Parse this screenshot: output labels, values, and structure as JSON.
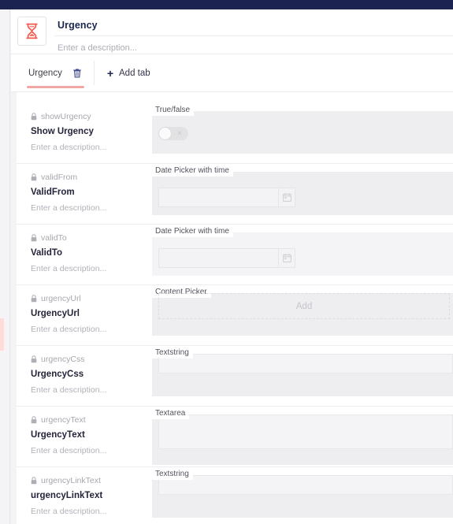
{
  "topbar": {
    "color": "#1b2350"
  },
  "header": {
    "icon": "hourglass-icon",
    "name": "Urgency",
    "description_placeholder": "Enter a description..."
  },
  "tabbar": {
    "tabs": [
      {
        "label": "Urgency",
        "active": true,
        "delete_icon": "trash-icon"
      }
    ],
    "add_tab_label": "Add tab",
    "add_tab_icon": "plus-icon"
  },
  "properties": [
    {
      "alias": "showUrgency",
      "label": "Show Urgency",
      "description_placeholder": "Enter a description...",
      "editor_type": "True/false",
      "lock_icon": "lock-icon",
      "control": "toggle",
      "toggle_state": "off",
      "toggle_mark": "×"
    },
    {
      "alias": "validFrom",
      "label": "ValidFrom",
      "description_placeholder": "Enter a description...",
      "editor_type": "Date Picker with time",
      "lock_icon": "lock-icon",
      "control": "datepicker",
      "value": "",
      "calendar_icon": "calendar-icon"
    },
    {
      "alias": "validTo",
      "label": "ValidTo",
      "description_placeholder": "Enter a description...",
      "editor_type": "Date Picker with time",
      "lock_icon": "lock-icon",
      "control": "datepicker",
      "value": "",
      "calendar_icon": "calendar-icon"
    },
    {
      "alias": "urgencyUrl",
      "label": "UrgencyUrl",
      "description_placeholder": "Enter a description...",
      "editor_type": "Content Picker",
      "lock_icon": "lock-icon",
      "control": "contentpicker",
      "add_label": "Add"
    },
    {
      "alias": "urgencyCss",
      "label": "UrgencyCss",
      "description_placeholder": "Enter a description...",
      "editor_type": "Textstring",
      "lock_icon": "lock-icon",
      "control": "textstring",
      "value": ""
    },
    {
      "alias": "urgencyText",
      "label": "UrgencyText",
      "description_placeholder": "Enter a description...",
      "editor_type": "Textarea",
      "lock_icon": "lock-icon",
      "control": "textarea",
      "value": ""
    },
    {
      "alias": "urgencyLinkText",
      "label": "urgencyLinkText",
      "description_placeholder": "Enter a description...",
      "editor_type": "Textstring",
      "lock_icon": "lock-icon",
      "control": "textstring",
      "value": ""
    }
  ],
  "colors": {
    "navy": "#1b2350",
    "accent_salmon": "#f0a8a4",
    "icon_red": "#f15a4f",
    "panel_grey": "#eeedef",
    "canvas_grey": "#f4f3f5"
  }
}
